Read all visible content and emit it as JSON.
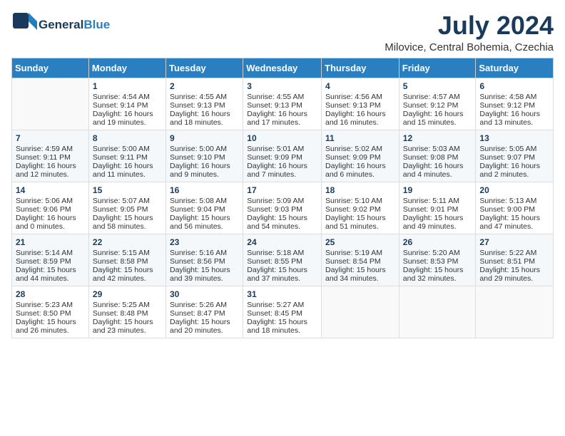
{
  "header": {
    "logo_general": "General",
    "logo_blue": "Blue",
    "month_title": "July 2024",
    "location": "Milovice, Central Bohemia, Czechia"
  },
  "columns": [
    "Sunday",
    "Monday",
    "Tuesday",
    "Wednesday",
    "Thursday",
    "Friday",
    "Saturday"
  ],
  "weeks": [
    [
      {
        "day": "",
        "sunrise": "",
        "sunset": "",
        "daylight": ""
      },
      {
        "day": "1",
        "sunrise": "Sunrise: 4:54 AM",
        "sunset": "Sunset: 9:14 PM",
        "daylight": "Daylight: 16 hours and 19 minutes."
      },
      {
        "day": "2",
        "sunrise": "Sunrise: 4:55 AM",
        "sunset": "Sunset: 9:13 PM",
        "daylight": "Daylight: 16 hours and 18 minutes."
      },
      {
        "day": "3",
        "sunrise": "Sunrise: 4:55 AM",
        "sunset": "Sunset: 9:13 PM",
        "daylight": "Daylight: 16 hours and 17 minutes."
      },
      {
        "day": "4",
        "sunrise": "Sunrise: 4:56 AM",
        "sunset": "Sunset: 9:13 PM",
        "daylight": "Daylight: 16 hours and 16 minutes."
      },
      {
        "day": "5",
        "sunrise": "Sunrise: 4:57 AM",
        "sunset": "Sunset: 9:12 PM",
        "daylight": "Daylight: 16 hours and 15 minutes."
      },
      {
        "day": "6",
        "sunrise": "Sunrise: 4:58 AM",
        "sunset": "Sunset: 9:12 PM",
        "daylight": "Daylight: 16 hours and 13 minutes."
      }
    ],
    [
      {
        "day": "7",
        "sunrise": "Sunrise: 4:59 AM",
        "sunset": "Sunset: 9:11 PM",
        "daylight": "Daylight: 16 hours and 12 minutes."
      },
      {
        "day": "8",
        "sunrise": "Sunrise: 5:00 AM",
        "sunset": "Sunset: 9:11 PM",
        "daylight": "Daylight: 16 hours and 11 minutes."
      },
      {
        "day": "9",
        "sunrise": "Sunrise: 5:00 AM",
        "sunset": "Sunset: 9:10 PM",
        "daylight": "Daylight: 16 hours and 9 minutes."
      },
      {
        "day": "10",
        "sunrise": "Sunrise: 5:01 AM",
        "sunset": "Sunset: 9:09 PM",
        "daylight": "Daylight: 16 hours and 7 minutes."
      },
      {
        "day": "11",
        "sunrise": "Sunrise: 5:02 AM",
        "sunset": "Sunset: 9:09 PM",
        "daylight": "Daylight: 16 hours and 6 minutes."
      },
      {
        "day": "12",
        "sunrise": "Sunrise: 5:03 AM",
        "sunset": "Sunset: 9:08 PM",
        "daylight": "Daylight: 16 hours and 4 minutes."
      },
      {
        "day": "13",
        "sunrise": "Sunrise: 5:05 AM",
        "sunset": "Sunset: 9:07 PM",
        "daylight": "Daylight: 16 hours and 2 minutes."
      }
    ],
    [
      {
        "day": "14",
        "sunrise": "Sunrise: 5:06 AM",
        "sunset": "Sunset: 9:06 PM",
        "daylight": "Daylight: 16 hours and 0 minutes."
      },
      {
        "day": "15",
        "sunrise": "Sunrise: 5:07 AM",
        "sunset": "Sunset: 9:05 PM",
        "daylight": "Daylight: 15 hours and 58 minutes."
      },
      {
        "day": "16",
        "sunrise": "Sunrise: 5:08 AM",
        "sunset": "Sunset: 9:04 PM",
        "daylight": "Daylight: 15 hours and 56 minutes."
      },
      {
        "day": "17",
        "sunrise": "Sunrise: 5:09 AM",
        "sunset": "Sunset: 9:03 PM",
        "daylight": "Daylight: 15 hours and 54 minutes."
      },
      {
        "day": "18",
        "sunrise": "Sunrise: 5:10 AM",
        "sunset": "Sunset: 9:02 PM",
        "daylight": "Daylight: 15 hours and 51 minutes."
      },
      {
        "day": "19",
        "sunrise": "Sunrise: 5:11 AM",
        "sunset": "Sunset: 9:01 PM",
        "daylight": "Daylight: 15 hours and 49 minutes."
      },
      {
        "day": "20",
        "sunrise": "Sunrise: 5:13 AM",
        "sunset": "Sunset: 9:00 PM",
        "daylight": "Daylight: 15 hours and 47 minutes."
      }
    ],
    [
      {
        "day": "21",
        "sunrise": "Sunrise: 5:14 AM",
        "sunset": "Sunset: 8:59 PM",
        "daylight": "Daylight: 15 hours and 44 minutes."
      },
      {
        "day": "22",
        "sunrise": "Sunrise: 5:15 AM",
        "sunset": "Sunset: 8:58 PM",
        "daylight": "Daylight: 15 hours and 42 minutes."
      },
      {
        "day": "23",
        "sunrise": "Sunrise: 5:16 AM",
        "sunset": "Sunset: 8:56 PM",
        "daylight": "Daylight: 15 hours and 39 minutes."
      },
      {
        "day": "24",
        "sunrise": "Sunrise: 5:18 AM",
        "sunset": "Sunset: 8:55 PM",
        "daylight": "Daylight: 15 hours and 37 minutes."
      },
      {
        "day": "25",
        "sunrise": "Sunrise: 5:19 AM",
        "sunset": "Sunset: 8:54 PM",
        "daylight": "Daylight: 15 hours and 34 minutes."
      },
      {
        "day": "26",
        "sunrise": "Sunrise: 5:20 AM",
        "sunset": "Sunset: 8:53 PM",
        "daylight": "Daylight: 15 hours and 32 minutes."
      },
      {
        "day": "27",
        "sunrise": "Sunrise: 5:22 AM",
        "sunset": "Sunset: 8:51 PM",
        "daylight": "Daylight: 15 hours and 29 minutes."
      }
    ],
    [
      {
        "day": "28",
        "sunrise": "Sunrise: 5:23 AM",
        "sunset": "Sunset: 8:50 PM",
        "daylight": "Daylight: 15 hours and 26 minutes."
      },
      {
        "day": "29",
        "sunrise": "Sunrise: 5:25 AM",
        "sunset": "Sunset: 8:48 PM",
        "daylight": "Daylight: 15 hours and 23 minutes."
      },
      {
        "day": "30",
        "sunrise": "Sunrise: 5:26 AM",
        "sunset": "Sunset: 8:47 PM",
        "daylight": "Daylight: 15 hours and 20 minutes."
      },
      {
        "day": "31",
        "sunrise": "Sunrise: 5:27 AM",
        "sunset": "Sunset: 8:45 PM",
        "daylight": "Daylight: 15 hours and 18 minutes."
      },
      {
        "day": "",
        "sunrise": "",
        "sunset": "",
        "daylight": ""
      },
      {
        "day": "",
        "sunrise": "",
        "sunset": "",
        "daylight": ""
      },
      {
        "day": "",
        "sunrise": "",
        "sunset": "",
        "daylight": ""
      }
    ]
  ]
}
